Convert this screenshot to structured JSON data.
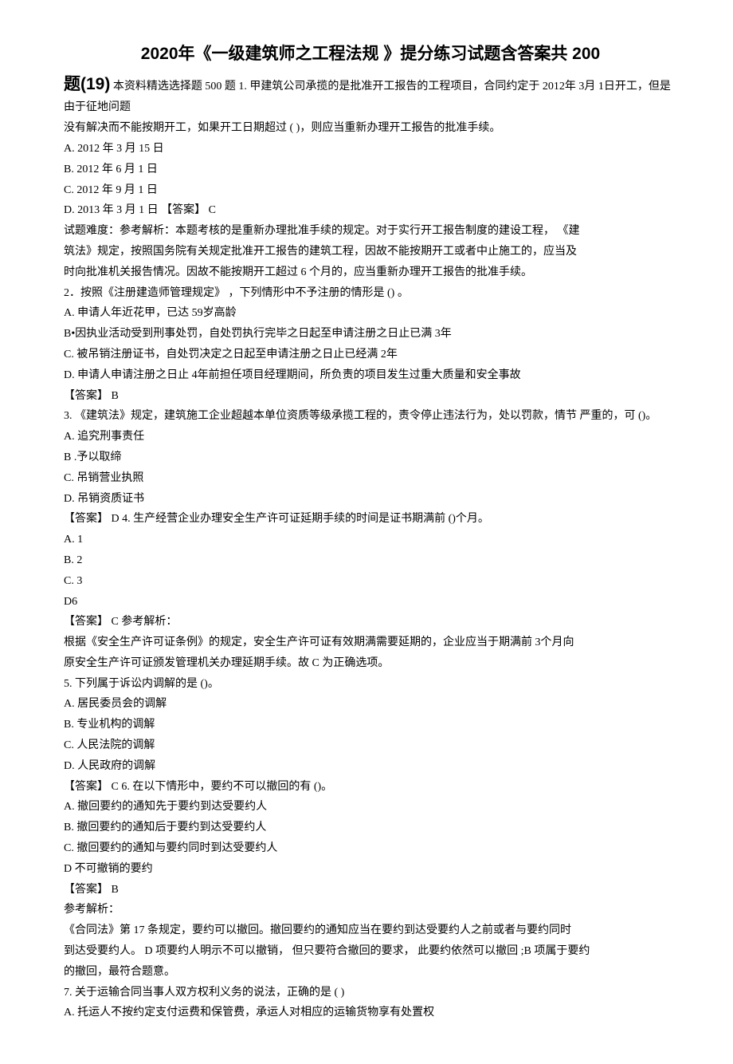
{
  "title": "2020年《一级建筑师之工程法规 》提分练习试题含答案共  200",
  "subtitle": "题(19)",
  "intro": " 本资料精选选择题 500 题  1.  甲建筑公司承揽的是批准开工报告的工程项目，合同约定于    2012年 3月 1日开工，但是由于征地问题",
  "line2": "没有解决而不能按期开工，如果开工日期超过       ( )，则应当重新办理开工报告的批准手续。",
  "q1_a": "A.     2012 年 3 月 15 日",
  "q1_b": "B.     2012 年 6 月 1 日",
  "q1_c": "C.     2012 年 9 月 1 日",
  "q1_d": "D.     2013 年 3 月 1 日 【答案】 C",
  "q1_exp1": "试题难度：参考解析：本题考核的是重新办理批准手续的规定。对于实行开工报告制度的建设工程，   《建",
  "q1_exp2": "筑法》规定，按照国务院有关规定批准开工报告的建筑工程，因故不能按期开工或者中止施工的，应当及",
  "q1_exp3": "时向批准机关报告情况。因故不能按期开工超过 6 个月的，应当重新办理开工报告的批准手续。",
  "q2": "2．按照《注册建造师管理规定》  ，下列情形中不予注册的情形是 () 。",
  "q2_a": "A.                                  申请人年近花甲，已达     59岁高龄",
  "q2_b": "B•因执业活动受到刑事处罚，自处罚执行完毕之日起至申请注册之日止已满              3年",
  "q2_c": "C. 被吊销注册证书，自处罚决定之日起至申请注册之日止已经满        2年",
  "q2_d": "D. 申请人申请注册之日止   4年前担任项目经理期间，所负责的项目发生过重大质量和安全事故",
  "q2_ans": "【答案】 B",
  "q3": "3.  《建筑法》规定，建筑施工企业超越本单位资质等级承揽工程的，责令停止违法行为，处以罚款，情节 严重的，可 ()。",
  "q3_a": "A. 追究刑事责任",
  "q3_b": "B .予以取缔",
  "q3_c": "C. 吊销营业执照",
  "q3_d": "D. 吊销资质证书",
  "q3_ans": "【答案】 D 4.  生产经营企业办理安全生产许可证延期手续的时间是证书期满前   ()个月。",
  "q4_a": "A. 1",
  "q4_b": "B. 2",
  "q4_c": "C. 3",
  "q4_d": "D6",
  "q4_ans": "【答案】 C 参考解析：",
  "q4_exp1": "根据《安全生产许可证条例》的规定，安全生产许可证有效期满需要延期的，企业应当于期满前                   3个月向",
  "q4_exp2": "原安全生产许可证颁发管理机关办理延期手续。故 C 为正确选项。",
  "q5": "5. 下列属于诉讼内调解的是 ()。",
  "q5_a": "A. 居民委员会的调解",
  "q5_b": "B. 专业机构的调解",
  "q5_c": "C. 人民法院的调解",
  "q5_d": "D. 人民政府的调解",
  "q5_ans": "【答案】 C 6.  在以下情形中，要约不可以撤回的有   ()。",
  "q6_a": "A. 撤回要约的通知先于要约到达受要约人",
  "q6_b": "B. 撤回要约的通知后于要约到达受要约人",
  "q6_c": "C. 撤回要约的通知与要约同时到达受要约人",
  "q6_d": "D 不可撤销的要约",
  "q6_ans": "【答案】 B",
  "q6_exp_h": "参考解析：",
  "q6_exp1": "《合同法》第 17 条规定，要约可以撤回。撤回要约的通知应当在要约到达受要约人之前或者与要约同时",
  "q6_exp2": "到达受要约人。  D 项要约人明示不可以撤销，  但只要符合撤回的要求，  此要约依然可以撤回 ;B 项属于要约",
  "q6_exp3": "的撤回，最符合题意。",
  "q7": "7. 关于运输合同当事人双方权利义务的说法，正确的是       ( )",
  "q7_a": "A. 托运人不按约定支付运费和保管费，承运人对相应的运输货物享有处置权"
}
